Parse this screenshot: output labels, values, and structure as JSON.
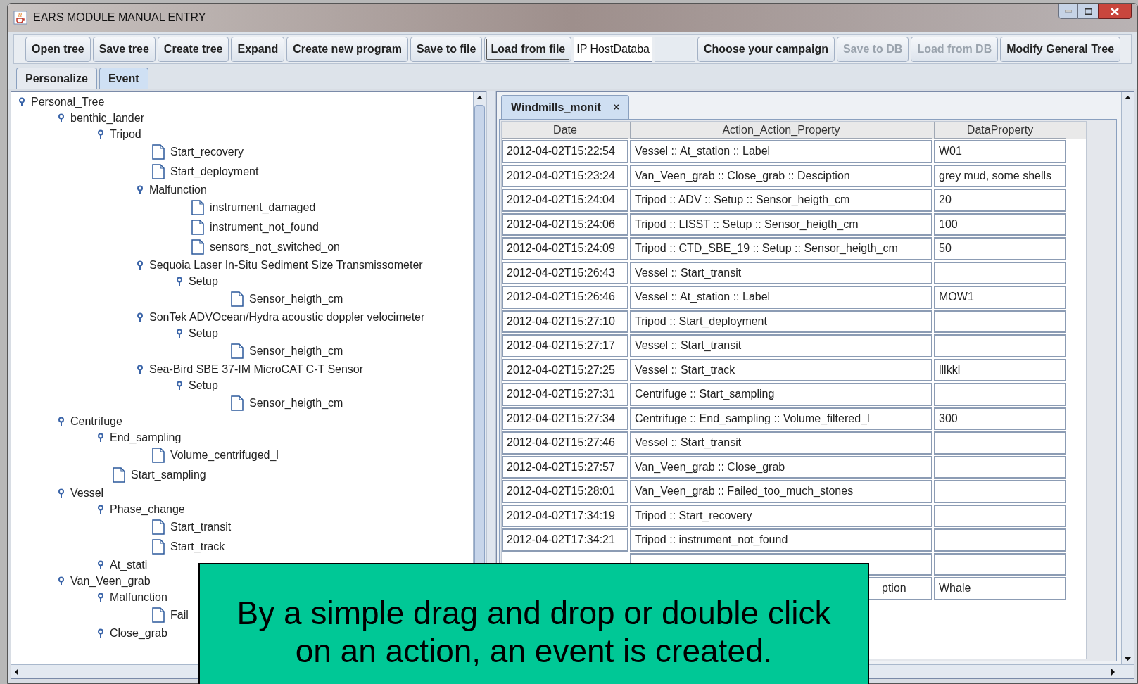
{
  "window": {
    "title": "EARS MODULE MANUAL ENTRY"
  },
  "toolbar": [
    {
      "kind": "button",
      "label": "Open tree",
      "disabled": false
    },
    {
      "kind": "button",
      "label": "Save tree",
      "disabled": false
    },
    {
      "kind": "button",
      "label": "Create tree",
      "disabled": false
    },
    {
      "kind": "button",
      "label": "Expand",
      "disabled": false
    },
    {
      "kind": "button",
      "label": "Create new program",
      "disabled": false
    },
    {
      "kind": "button",
      "label": "Save to file",
      "disabled": false
    },
    {
      "kind": "focused",
      "label": "Load from file",
      "disabled": false
    },
    {
      "kind": "field",
      "value": "IP HostDataba"
    },
    {
      "kind": "blank"
    },
    {
      "kind": "button",
      "label": "Choose your campaign",
      "disabled": false
    },
    {
      "kind": "button",
      "label": "Save to DB",
      "disabled": true
    },
    {
      "kind": "button",
      "label": "Load from DB",
      "disabled": true
    },
    {
      "kind": "button",
      "label": "Modify General Tree",
      "disabled": false
    }
  ],
  "tabs": [
    {
      "label": "Personalize",
      "selected": false
    },
    {
      "label": "Event",
      "selected": true
    }
  ],
  "tree": [
    {
      "label": "Personal_Tree",
      "children": [
        {
          "label": "benthic_lander",
          "children": [
            {
              "label": "Tripod",
              "children": [
                {
                  "label": "Start_recovery"
                },
                {
                  "label": "Start_deployment"
                },
                {
                  "label": "Malfunction",
                  "children": [
                    {
                      "label": "instrument_damaged"
                    },
                    {
                      "label": "instrument_not_found"
                    },
                    {
                      "label": "sensors_not_switched_on"
                    }
                  ]
                },
                {
                  "label": "Sequoia Laser In-Situ Sediment Size Transmissometer",
                  "children": [
                    {
                      "label": "Setup",
                      "children": [
                        {
                          "label": "Sensor_heigth_cm"
                        }
                      ]
                    }
                  ]
                },
                {
                  "label": "SonTek ADVOcean/Hydra acoustic doppler velocimeter",
                  "children": [
                    {
                      "label": "Setup",
                      "children": [
                        {
                          "label": "Sensor_heigth_cm"
                        }
                      ]
                    }
                  ]
                },
                {
                  "label": "Sea-Bird SBE 37-IM MicroCAT C-T Sensor",
                  "children": [
                    {
                      "label": "Setup",
                      "children": [
                        {
                          "label": "Sensor_heigth_cm"
                        }
                      ]
                    }
                  ]
                }
              ]
            }
          ]
        },
        {
          "label": "Centrifuge",
          "children": [
            {
              "label": "End_sampling",
              "children": [
                {
                  "label": "Volume_centrifuged_l"
                }
              ]
            },
            {
              "label": "Start_sampling"
            }
          ]
        },
        {
          "label": "Vessel",
          "children": [
            {
              "label": "Phase_change",
              "children": [
                {
                  "label": "Start_transit"
                },
                {
                  "label": "Start_track"
                }
              ]
            },
            {
              "label": "At_stati",
              "kind": "node"
            }
          ]
        },
        {
          "label": "Van_Veen_grab",
          "children": [
            {
              "label": "Malfunction",
              "children": [
                {
                  "label": "Fail"
                }
              ]
            },
            {
              "label": "Close_grab",
              "kind": "node"
            }
          ]
        }
      ]
    }
  ],
  "event_tab": {
    "label": "Windmills_monit",
    "close": "×"
  },
  "table": {
    "columns": [
      "Date",
      "Action_Action_Property",
      "DataProperty"
    ],
    "rows": [
      {
        "kind": "entry",
        "date": "2012-04-02T15:22:54",
        "action": "Vessel ::  At_station ::  Label",
        "data": "W01"
      },
      {
        "kind": "entry",
        "date": "2012-04-02T15:23:24",
        "action": "Van_Veen_grab ::  Close_grab ::  Desciption",
        "data": "grey mud, some shells"
      },
      {
        "kind": "entry",
        "date": "2012-04-02T15:24:04",
        "action": "Tripod ::  ADV ::  Setup ::  Sensor_heigth_cm",
        "data": "20"
      },
      {
        "kind": "entry",
        "date": "2012-04-02T15:24:06",
        "action": "Tripod ::  LISST ::  Setup ::  Sensor_heigth_cm",
        "data": "100"
      },
      {
        "kind": "entry",
        "date": "2012-04-02T15:24:09",
        "action": "Tripod ::  CTD_SBE_19 ::  Setup ::  Sensor_heigth_cm",
        "data": "50"
      },
      {
        "kind": "entry",
        "date": "2012-04-02T15:26:43",
        "action": "Vessel ::  Start_transit"
      },
      {
        "kind": "entry",
        "date": "2012-04-02T15:26:46",
        "action": "Vessel ::  At_station ::  Label",
        "data": "MOW1"
      },
      {
        "kind": "entry",
        "date": "2012-04-02T15:27:10",
        "action": "Tripod ::  Start_deployment"
      },
      {
        "kind": "entry",
        "date": "2012-04-02T15:27:17",
        "action": "Vessel ::  Start_transit"
      },
      {
        "kind": "entry",
        "date": "2012-04-02T15:27:25",
        "action": "Vessel ::  Start_track",
        "data": "lllkkl"
      },
      {
        "kind": "entry",
        "date": "2012-04-02T15:27:31",
        "action": "Centrifuge ::  Start_sampling"
      },
      {
        "kind": "entry",
        "date": "2012-04-02T15:27:34",
        "action": "Centrifuge ::  End_sampling ::  Volume_filtered_l",
        "data": "300"
      },
      {
        "kind": "entry",
        "date": "2012-04-02T15:27:46",
        "action": "Vessel ::  Start_transit"
      },
      {
        "kind": "entry",
        "date": "2012-04-02T15:27:57",
        "action": "Van_Veen_grab ::  Close_grab"
      },
      {
        "kind": "entry",
        "date": "2012-04-02T15:28:01",
        "action": "Van_Veen_grab ::  Failed_too_much_stones"
      },
      {
        "kind": "entry",
        "date": "2012-04-02T17:34:19",
        "action": "Tripod ::  Start_recovery"
      },
      {
        "kind": "entry",
        "date": "2012-04-02T17:34:21",
        "action": "Tripod ::  instrument_not_found"
      },
      {
        "kind": "covered"
      },
      {
        "kind": "covered",
        "action": "ption",
        "data": "Whale"
      }
    ]
  },
  "callout": {
    "text": "By a simple drag and drop or double click on an action, an event is created."
  }
}
